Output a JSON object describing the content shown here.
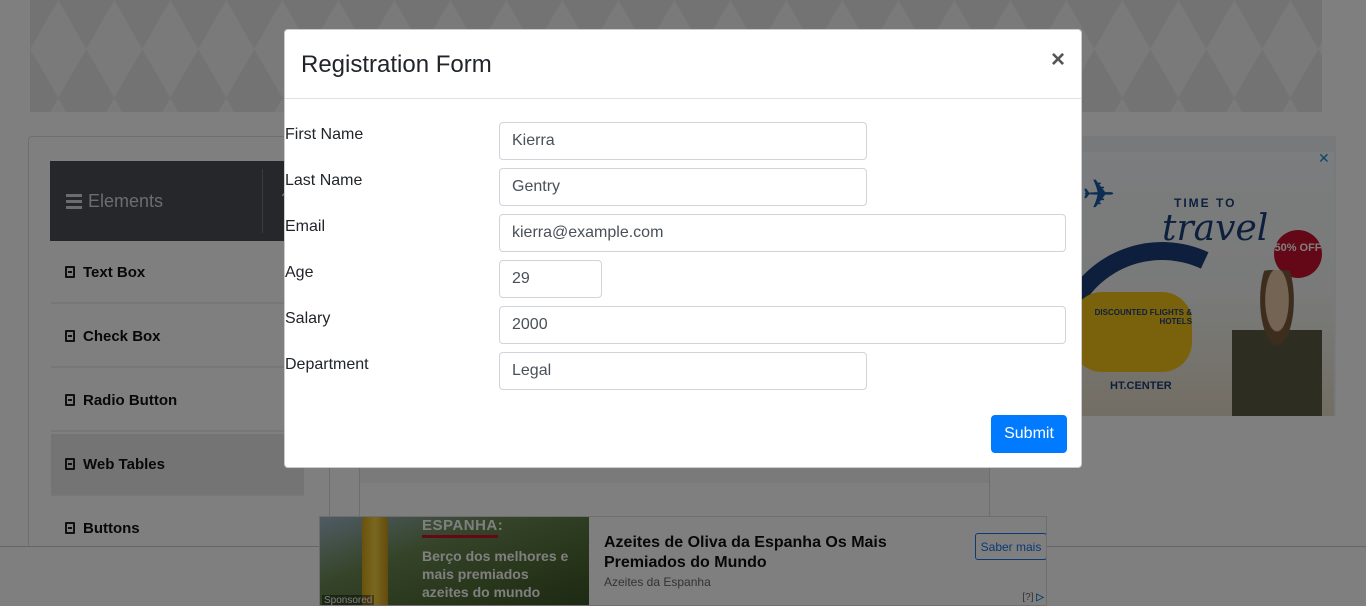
{
  "sidebar": {
    "header": "Elements",
    "items": [
      {
        "label": "Text Box"
      },
      {
        "label": "Check Box"
      },
      {
        "label": "Radio Button"
      },
      {
        "label": "Web Tables"
      },
      {
        "label": "Buttons"
      }
    ]
  },
  "right_ad": {
    "line1": "TIME TO",
    "line2": "travel",
    "badge": "50% OFF",
    "promo": "DISCOUNTED FLIGHTS & HOTELS",
    "site": "HT.CENTER",
    "close_icon": "close-x-icon"
  },
  "modal": {
    "title": "Registration Form",
    "close_label": "×",
    "fields": [
      {
        "label": "First Name",
        "value": "Kierra"
      },
      {
        "label": "Last Name",
        "value": "Gentry"
      },
      {
        "label": "Email",
        "value": "kierra@example.com"
      },
      {
        "label": "Age",
        "value": "29"
      },
      {
        "label": "Salary",
        "value": "2000"
      },
      {
        "label": "Department",
        "value": "Legal"
      }
    ],
    "submit_label": "Submit"
  },
  "bottom_ad": {
    "image_headline": "ESPANHA:",
    "image_sub": "Berço dos melhores e mais premiados azeites do mundo",
    "sponsored": "Sponsored",
    "title": "Azeites de Oliva da Espanha Os Mais Premiados do Mundo",
    "advertiser": "Azeites da Espanha",
    "cta": "Saber mais",
    "adinfo": "[?]"
  },
  "colors": {
    "primary": "#007bff",
    "sidebar_header": "#4a4e55",
    "overlay": "rgba(0,0,0,0.5)"
  }
}
